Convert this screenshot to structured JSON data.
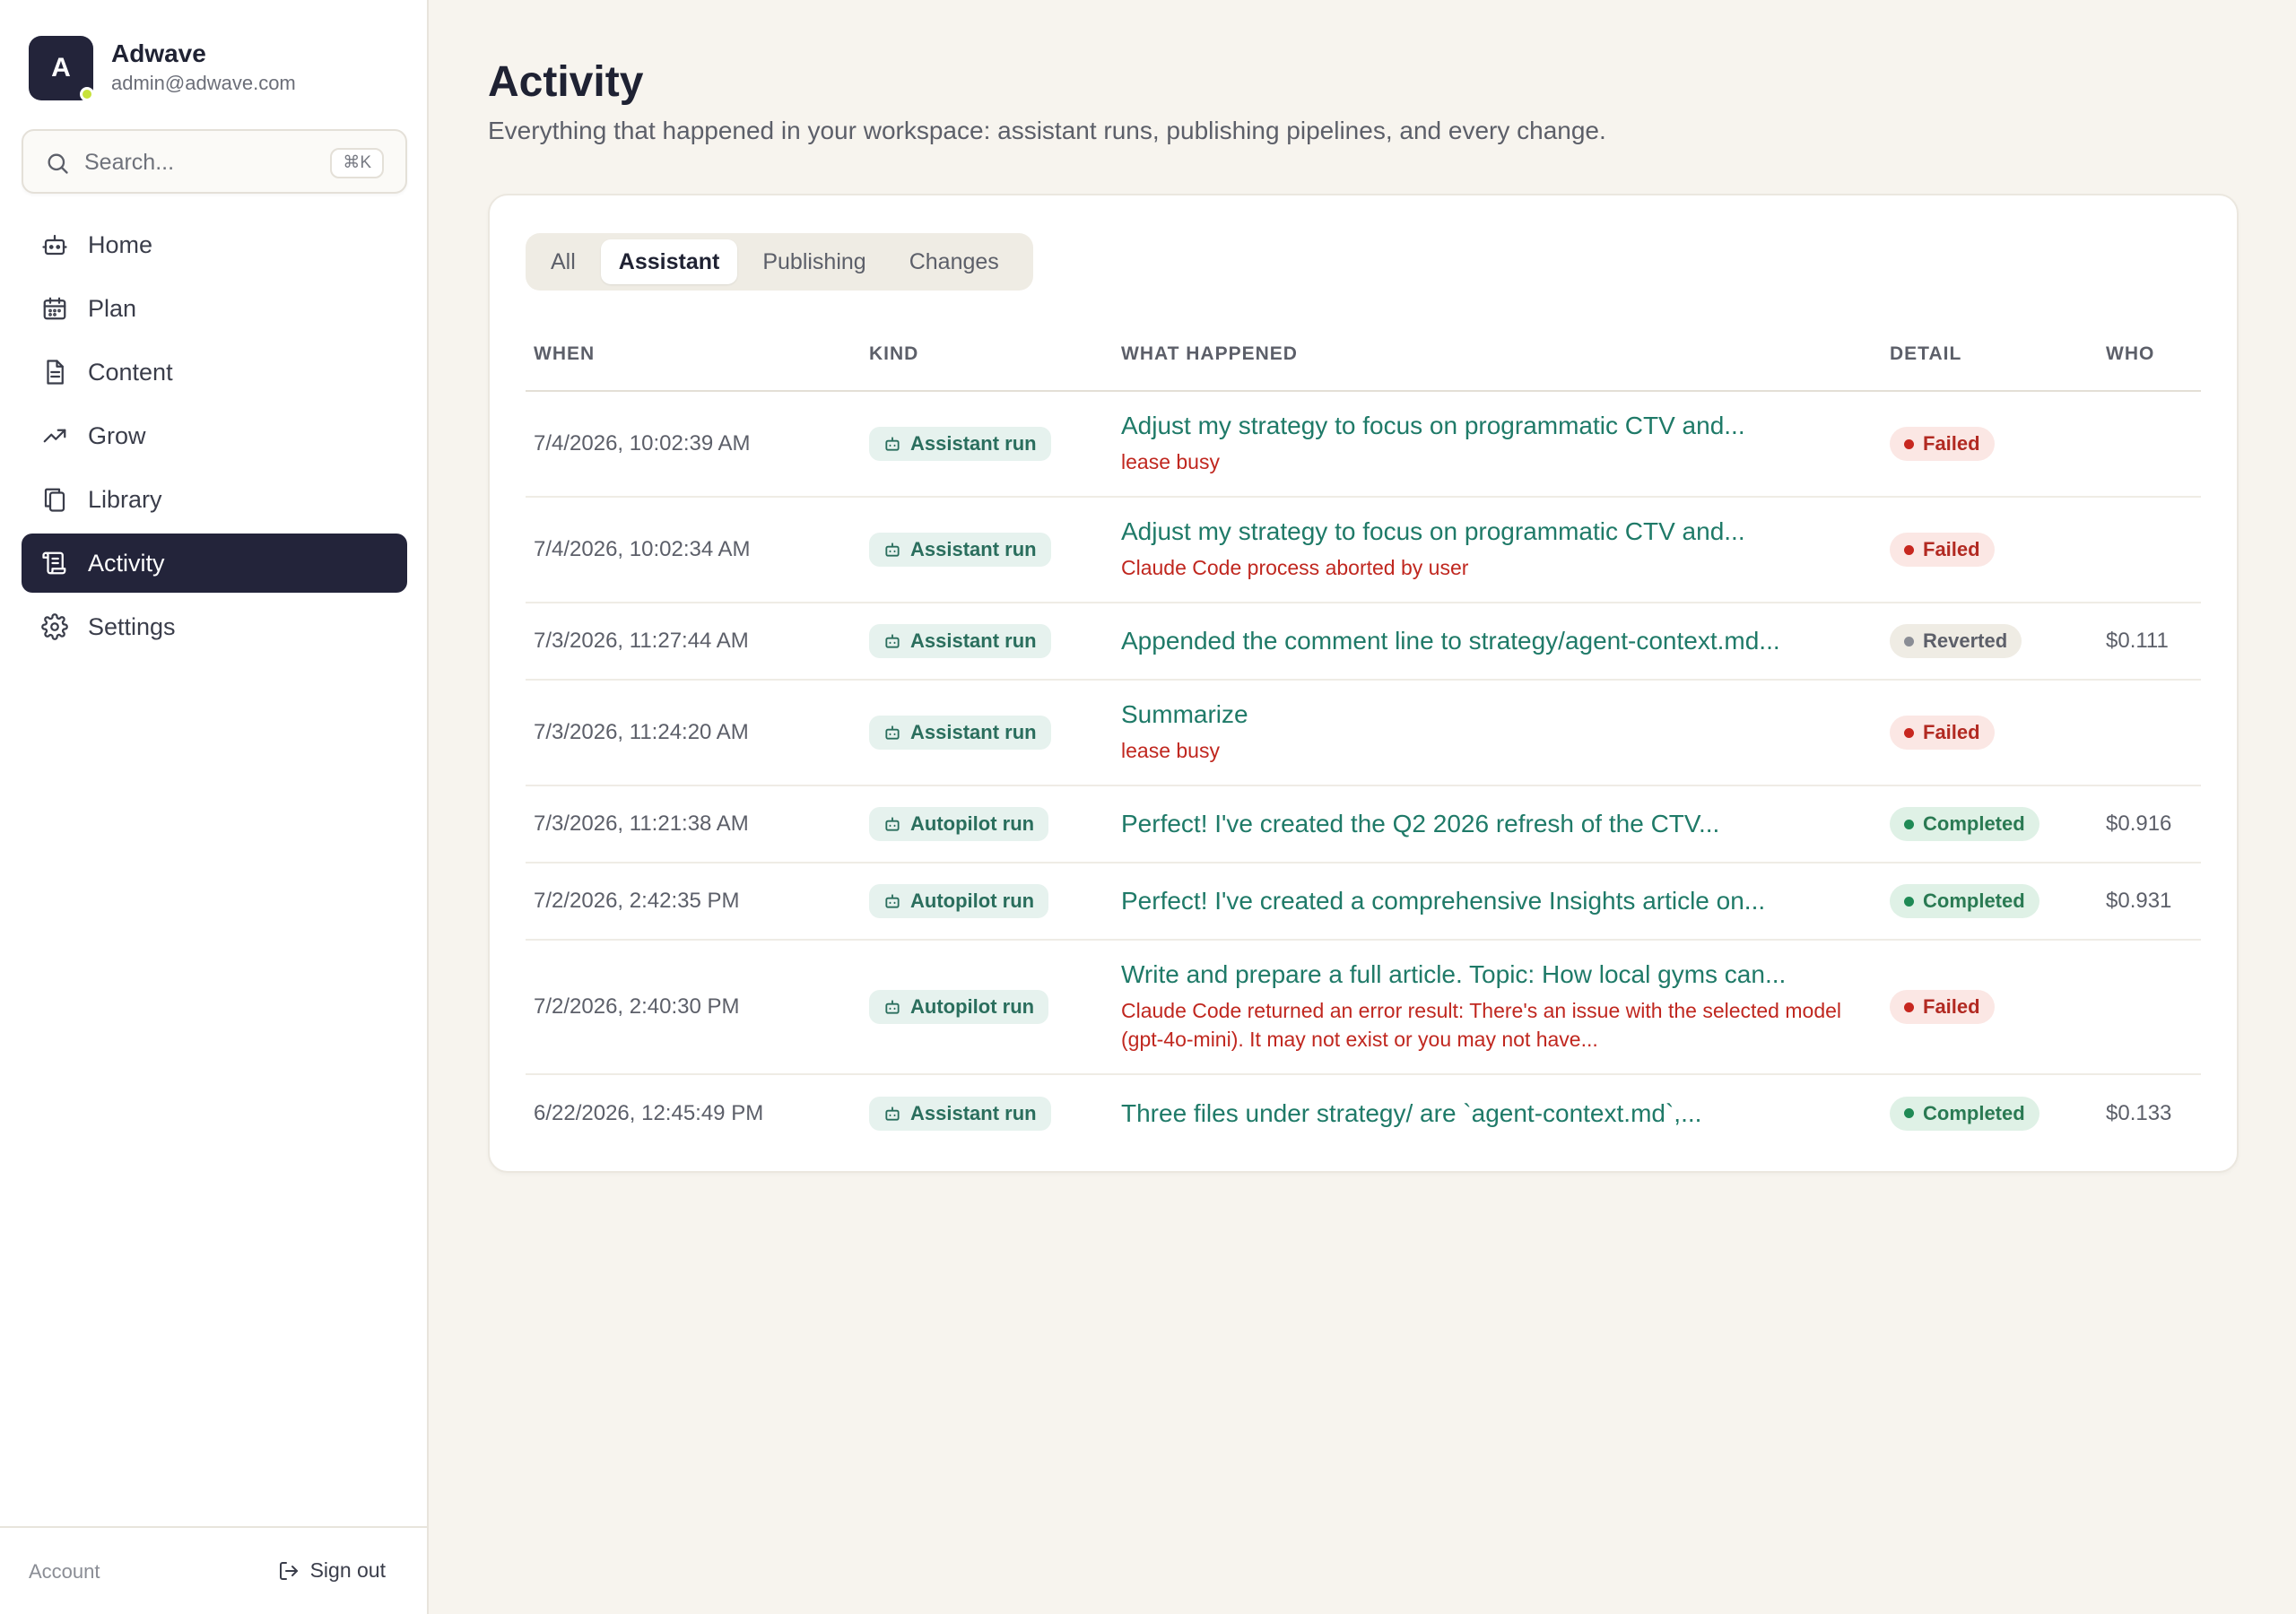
{
  "workspace": {
    "avatar_letter": "A",
    "name": "Adwave",
    "email": "admin@adwave.com"
  },
  "search": {
    "placeholder": "Search...",
    "shortcut": "⌘K"
  },
  "nav": [
    {
      "label": "Home",
      "icon": "robot-icon"
    },
    {
      "label": "Plan",
      "icon": "calendar-icon"
    },
    {
      "label": "Content",
      "icon": "document-icon"
    },
    {
      "label": "Grow",
      "icon": "trending-up-icon"
    },
    {
      "label": "Library",
      "icon": "copy-icon"
    },
    {
      "label": "Activity",
      "icon": "scroll-icon",
      "active": true
    },
    {
      "label": "Settings",
      "icon": "gear-icon"
    }
  ],
  "footer": {
    "account": "Account",
    "sign_out": "Sign out"
  },
  "page": {
    "title": "Activity",
    "subtitle": "Everything that happened in your workspace: assistant runs, publishing pipelines, and every change."
  },
  "tabs": [
    {
      "label": "All"
    },
    {
      "label": "Assistant",
      "active": true
    },
    {
      "label": "Publishing"
    },
    {
      "label": "Changes"
    }
  ],
  "table": {
    "headers": {
      "when": "WHEN",
      "kind": "KIND",
      "what": "WHAT HAPPENED",
      "detail": "DETAIL",
      "who": "WHO"
    },
    "rows": [
      {
        "when": "7/4/2026, 10:02:39 AM",
        "kind": "Assistant run",
        "what": "Adjust my strategy to focus on programmatic CTV and...",
        "error": "lease busy",
        "status": "Failed",
        "who": ""
      },
      {
        "when": "7/4/2026, 10:02:34 AM",
        "kind": "Assistant run",
        "what": "Adjust my strategy to focus on programmatic CTV and...",
        "error": "Claude Code process aborted by user",
        "status": "Failed",
        "who": ""
      },
      {
        "when": "7/3/2026, 11:27:44 AM",
        "kind": "Assistant run",
        "what": "Appended the comment line to strategy/agent-context.md...",
        "error": "",
        "status": "Reverted",
        "who": "$0.111"
      },
      {
        "when": "7/3/2026, 11:24:20 AM",
        "kind": "Assistant run",
        "what": "Summarize",
        "error": "lease busy",
        "status": "Failed",
        "who": ""
      },
      {
        "when": "7/3/2026, 11:21:38 AM",
        "kind": "Autopilot run",
        "what": "Perfect! I've created the Q2 2026 refresh of the CTV...",
        "error": "",
        "status": "Completed",
        "who": "$0.916"
      },
      {
        "when": "7/2/2026, 2:42:35 PM",
        "kind": "Autopilot run",
        "what": "Perfect! I've created a comprehensive Insights article on...",
        "error": "",
        "status": "Completed",
        "who": "$0.931"
      },
      {
        "when": "7/2/2026, 2:40:30 PM",
        "kind": "Autopilot run",
        "what": "Write and prepare a full article. Topic: How local gyms can...",
        "error": "Claude Code returned an error result: There's an issue with the selected model (gpt-4o-mini). It may not exist or you may not have...",
        "status": "Failed",
        "who": ""
      },
      {
        "when": "6/22/2026, 12:45:49 PM",
        "kind": "Assistant run",
        "what": "Three files under strategy/ are `agent-context.md`,...",
        "error": "",
        "status": "Completed",
        "who": "$0.133"
      }
    ]
  }
}
